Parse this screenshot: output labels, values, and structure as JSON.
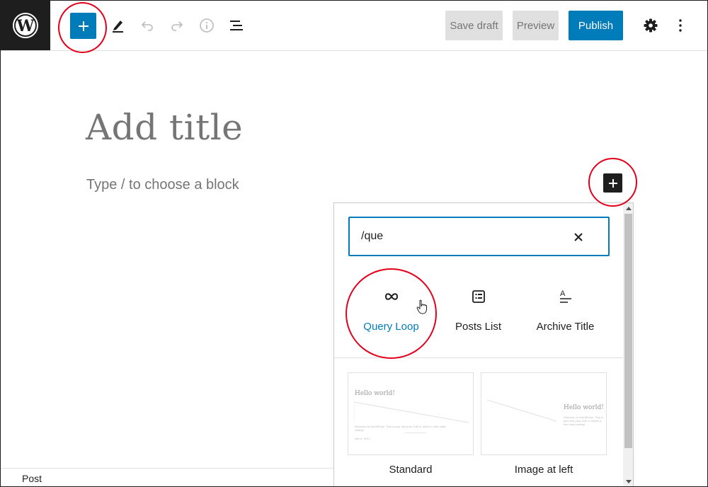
{
  "toolbar": {
    "logo_icon": "wordpress-logo",
    "inserter_icon": "plus-icon",
    "tools": [
      "edit-pencil-icon",
      "undo-icon",
      "redo-icon",
      "info-icon",
      "list-view-icon"
    ],
    "save_draft_label": "Save draft",
    "preview_label": "Preview",
    "publish_label": "Publish",
    "settings_icon": "gear-icon",
    "more_icon": "more-vertical-icon"
  },
  "editor": {
    "title_placeholder": "Add title",
    "paragraph_placeholder": "Type / to choose a block"
  },
  "inserter": {
    "search_value": "/que",
    "results": [
      {
        "label": "Query Loop",
        "icon": "loop-icon",
        "active": true
      },
      {
        "label": "Posts List",
        "icon": "posts-list-icon",
        "active": false
      },
      {
        "label": "Archive Title",
        "icon": "archive-title-icon",
        "active": false
      }
    ],
    "patterns": [
      {
        "label": "Standard",
        "preview_title": "Hello world!",
        "preview_text": "Welcome to WordPress. This is your first post. Edit or delete it, then start writing!",
        "preview_meta": "Mar 8, 2021"
      },
      {
        "label": "Image at left",
        "preview_title": "Hello world!",
        "preview_text": "Welcome to WordPress. This is your first post. Edit or delete it, then start writing!",
        "preview_meta": ""
      }
    ]
  },
  "footer": {
    "label": "Post"
  },
  "colors": {
    "accent": "#007cba",
    "dark": "#1e1e1e",
    "annotation": "#e4001b"
  }
}
